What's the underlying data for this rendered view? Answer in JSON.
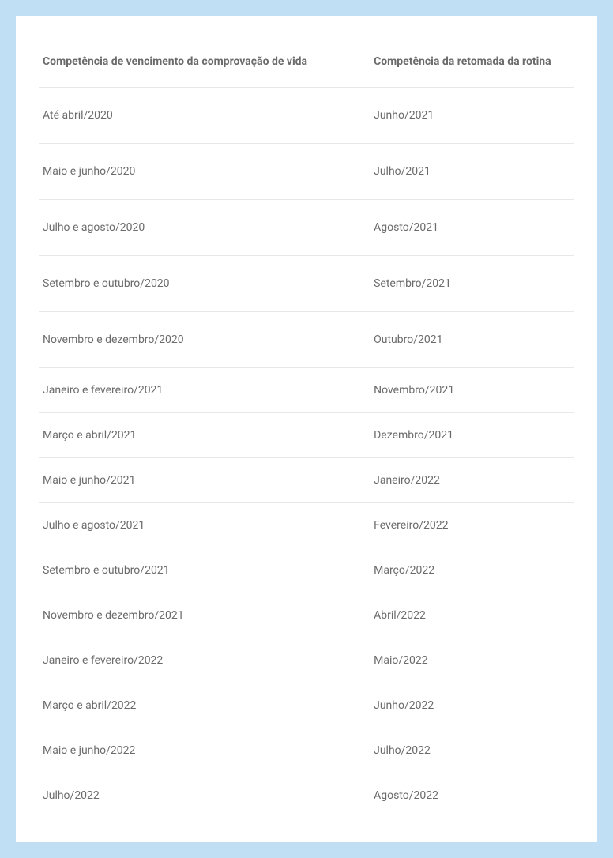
{
  "table": {
    "headers": {
      "left": "Competência de vencimento da comprovação de vida",
      "right": "Competência da retomada da rotina"
    },
    "rows": [
      {
        "left": "Até abril/2020",
        "right": "Junho/2021",
        "tight": false
      },
      {
        "left": "Maio e junho/2020",
        "right": "Julho/2021",
        "tight": false
      },
      {
        "left": "Julho e agosto/2020",
        "right": "Agosto/2021",
        "tight": false
      },
      {
        "left": "Setembro e outubro/2020",
        "right": "Setembro/2021",
        "tight": false
      },
      {
        "left": "Novembro e dezembro/2020",
        "right": "Outubro/2021",
        "tight": false
      },
      {
        "left": "Janeiro e fevereiro/2021",
        "right": "Novembro/2021",
        "tight": true
      },
      {
        "left": "Março e abril/2021",
        "right": "Dezembro/2021",
        "tight": true
      },
      {
        "left": "Maio e junho/2021",
        "right": "Janeiro/2022",
        "tight": true
      },
      {
        "left": "Julho e agosto/2021",
        "right": "Fevereiro/2022",
        "tight": true
      },
      {
        "left": "Setembro e outubro/2021",
        "right": "Março/2022",
        "tight": true
      },
      {
        "left": "Novembro e dezembro/2021",
        "right": "Abril/2022",
        "tight": true
      },
      {
        "left": "Janeiro e fevereiro/2022",
        "right": "Maio/2022",
        "tight": true
      },
      {
        "left": "Março e abril/2022",
        "right": "Junho/2022",
        "tight": true
      },
      {
        "left": "Maio e junho/2022",
        "right": "Julho/2022",
        "tight": true
      },
      {
        "left": "Julho/2022",
        "right": "Agosto/2022",
        "tight": true
      }
    ]
  }
}
